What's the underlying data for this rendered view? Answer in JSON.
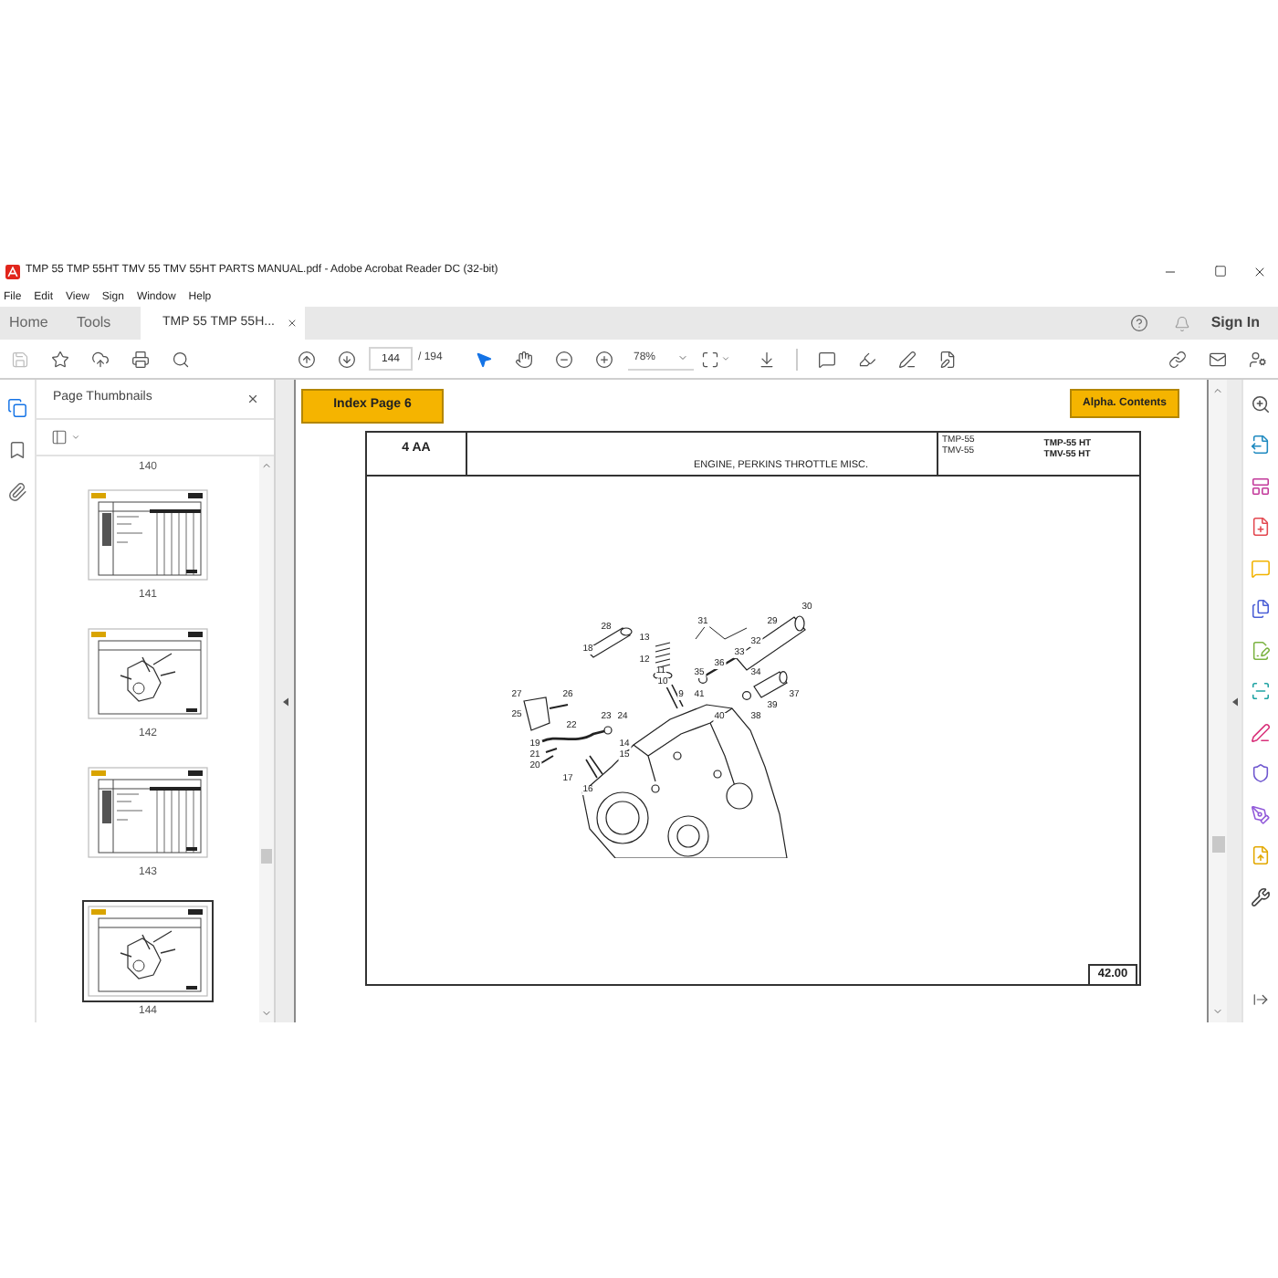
{
  "window": {
    "title": "TMP 55 TMP 55HT TMV 55 TMV 55HT PARTS MANUAL.pdf - Adobe Acrobat Reader DC (32-bit)"
  },
  "menu": [
    "File",
    "Edit",
    "View",
    "Sign",
    "Window",
    "Help"
  ],
  "tabs": [
    {
      "label": "Home",
      "selected": false,
      "closable": false
    },
    {
      "label": "Tools",
      "selected": false,
      "closable": false
    },
    {
      "label": "TMP 55 TMP 55H...",
      "selected": true,
      "closable": true
    }
  ],
  "account": {
    "sign_in": "Sign In"
  },
  "toolbar": {
    "page": "144",
    "page_count": "/ 194",
    "zoom": "78%",
    "modes": [
      {
        "kind": "select",
        "selected": true
      },
      {
        "kind": "hand",
        "selected": false
      }
    ]
  },
  "nav_rail": [
    {
      "kind": "pages",
      "selected": true
    },
    {
      "kind": "bookmarks",
      "selected": false
    },
    {
      "kind": "attachments",
      "selected": false
    }
  ],
  "thumbnails_panel": {
    "title": "Page Thumbnails",
    "top_label": "140",
    "pages": [
      {
        "label": "141",
        "kind": "table",
        "selected": false
      },
      {
        "label": "142",
        "kind": "drawing",
        "selected": false
      },
      {
        "label": "143",
        "kind": "table",
        "selected": false
      },
      {
        "label": "144",
        "kind": "drawing",
        "selected": true
      }
    ]
  },
  "document": {
    "index_link": "Index Page 6",
    "contents_link": "Alpha. Contents",
    "section": "4 AA",
    "heading": "ENGINE, PERKINS THROTTLE MISC.",
    "models_left": [
      "TMP-55",
      "TMV-55"
    ],
    "models_right": [
      "TMP-55 HT",
      "TMV-55 HT"
    ],
    "callouts": [
      "30",
      "31",
      "29",
      "28",
      "13",
      "32",
      "18",
      "33",
      "12",
      "36",
      "11",
      "35",
      "34",
      "10",
      "27",
      "26",
      "9",
      "41",
      "37",
      "39",
      "25",
      "23",
      "24",
      "40",
      "38",
      "22",
      "19",
      "14",
      "21",
      "15",
      "20",
      "17",
      "16"
    ],
    "page_number": "42.00"
  },
  "tools_rail": [
    {
      "kind": "search",
      "color": "#505050"
    },
    {
      "kind": "export",
      "color": "#1f8ac0"
    },
    {
      "kind": "organize",
      "color": "#c2389a"
    },
    {
      "kind": "create",
      "color": "#e34850"
    },
    {
      "kind": "comment",
      "color": "#f2b300"
    },
    {
      "kind": "combine",
      "color": "#4b5fd6"
    },
    {
      "kind": "edit",
      "color": "#7cb342"
    },
    {
      "kind": "scan",
      "color": "#1fa3a3"
    },
    {
      "kind": "fill-sign",
      "color": "#d9317a"
    },
    {
      "kind": "protect",
      "color": "#6e56cf"
    },
    {
      "kind": "sign",
      "color": "#9159d9"
    },
    {
      "kind": "send",
      "color": "#e3a800"
    },
    {
      "kind": "more",
      "color": "#404040"
    }
  ]
}
